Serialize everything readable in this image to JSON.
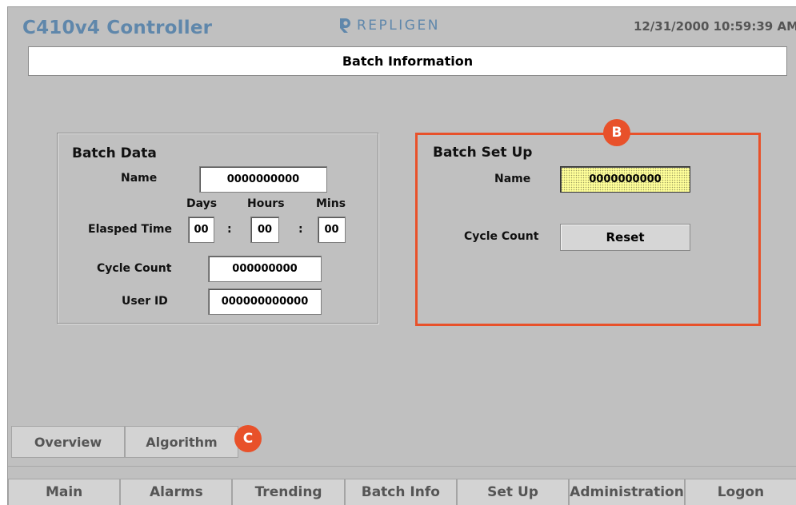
{
  "header": {
    "app_title": "C410v4 Controller",
    "logo_text": "REPLIGEN",
    "datetime": "12/31/2000 10:59:39 AM"
  },
  "page_title": "Batch Information",
  "batch_data": {
    "title": "Batch Data",
    "name_label": "Name",
    "name_value": "0000000000",
    "days_label": "Days",
    "hours_label": "Hours",
    "mins_label": "Mins",
    "elapsed_label": "Elasped Time",
    "days_value": "00",
    "hours_value": "00",
    "mins_value": "00",
    "separator": ":",
    "cycle_label": "Cycle Count",
    "cycle_value": "000000000",
    "user_label": "User ID",
    "user_value": "000000000000"
  },
  "batch_setup": {
    "title": "Batch Set Up",
    "name_label": "Name",
    "name_value": "0000000000",
    "cycle_label": "Cycle Count",
    "reset_label": "Reset"
  },
  "markers": {
    "b": "B",
    "c": "C"
  },
  "sub_tabs": [
    "Overview",
    "Algorithm"
  ],
  "nav_tabs": [
    "Main",
    "Alarms",
    "Trending",
    "Batch Info",
    "Set Up",
    "Administration",
    "Logon"
  ],
  "colors": {
    "accent": "#e8512a",
    "brand": "#5f87ab",
    "background": "#c0c0c0"
  },
  "icons": {
    "logo": "repligen-logo-icon"
  }
}
